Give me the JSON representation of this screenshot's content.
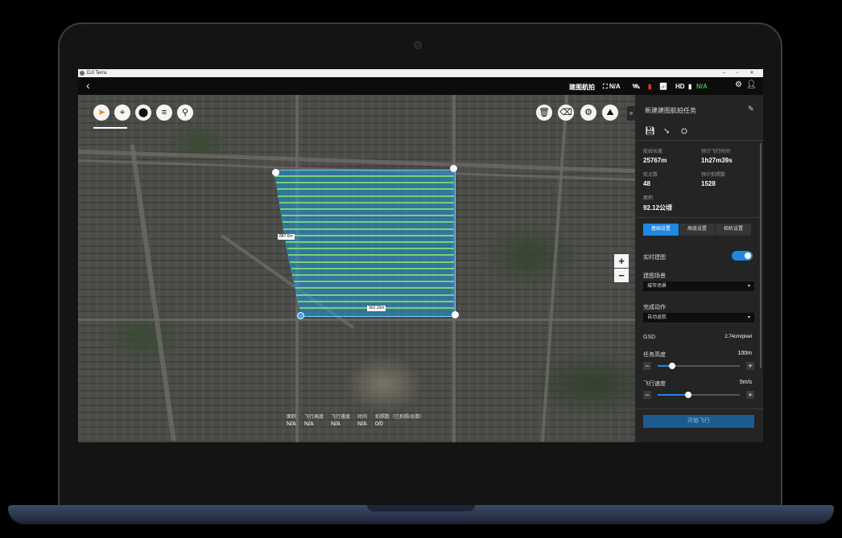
{
  "window": {
    "title": "DJI Terra",
    "minimize": "–",
    "maximize": "▫",
    "close": "✕"
  },
  "topbar": {
    "back": "‹",
    "mode": "建图航拍",
    "stats": [
      {
        "name": "rc-signal",
        "text": "⛶ N/A",
        "color": "#ffffff"
      },
      {
        "name": "gps",
        "text": "🛰︎",
        "color": "#ffffff"
      },
      {
        "name": "battery",
        "text": "▮",
        "color": "#e53935"
      },
      {
        "name": "rc",
        "text": "📶︎",
        "color": "#ffffff"
      },
      {
        "name": "hd",
        "text": "HD",
        "color": "#ffffff"
      },
      {
        "name": "hd-signal",
        "text": "▮",
        "color": "#ffffff"
      },
      {
        "name": "drone-battery",
        "text": "N/A",
        "color": "#4caf50"
      }
    ],
    "settings": "⚙",
    "user": "👤︎"
  },
  "map": {
    "tools": [
      "➤",
      "⌖",
      "⬤",
      "≡",
      "⚲"
    ],
    "right_tools": [
      "🗑︎",
      "⌫",
      "⚙",
      "⛰︎"
    ],
    "collapse": "»",
    "zoom_in": "+",
    "zoom_out": "−",
    "labels": {
      "left": "887.6m",
      "bottom": "962.15m"
    },
    "stats": {
      "labels": [
        "面积",
        "飞行高度",
        "飞行速度",
        "时间",
        "拍照数（已拍照/总数）"
      ],
      "values": [
        "N/A",
        "N/A",
        "N/A",
        "N/A",
        "0/0"
      ]
    }
  },
  "panel": {
    "title": "新建建图航拍任务",
    "edit_icon": "✎",
    "icons": [
      "💾︎",
      "➘",
      "⛭"
    ],
    "summary": {
      "length_label": "航线长度",
      "length": "25767m",
      "time_label": "预计飞行时间",
      "time": "1h27m39s",
      "points_label": "航点数",
      "points": "48",
      "photos_label": "预计拍照数",
      "photos": "1528",
      "area_label": "面积",
      "area": "92.12公顷"
    },
    "tabs": [
      "基础设置",
      "高级设置",
      "相机设置"
    ],
    "realtime_label": "实时建图",
    "realtime_on": true,
    "scene_label": "建图场景",
    "scene_value": "城市场景",
    "finish_label": "完成动作",
    "finish_value": "自动返航",
    "gsd_label": "GSD",
    "gsd_value": "2.74cm/pixel",
    "altitude_label": "任务高度",
    "altitude_value": "100m",
    "altitude_fraction": 0.18,
    "speed_label": "飞行速度",
    "speed_value": "5m/s",
    "speed_fraction": 0.37,
    "minus": "−",
    "plus": "+",
    "caret": "▾",
    "start_button": "开始飞行"
  }
}
